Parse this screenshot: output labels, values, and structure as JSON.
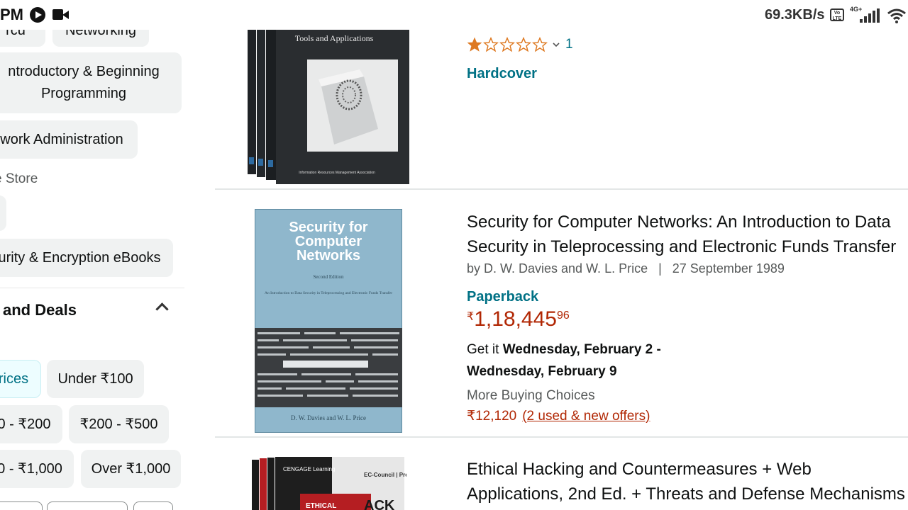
{
  "status_bar": {
    "time": "PM",
    "network_speed": "69.3KB/s",
    "volte": "Vo LTE",
    "network_type": "4G+"
  },
  "sidebar": {
    "partial_pills": [
      "rcu",
      "Networking"
    ],
    "intro_programming": "ntroductory & Beginning\nProgramming",
    "network_admin": "work Administration",
    "store_label": "e Store",
    "encryption_ebooks": "urity & Encryption eBooks",
    "deals_heading": "and Deals",
    "price_filters": {
      "all_prices": "rices",
      "under_100": "Under ₹100",
      "r100_200": "0 - ₹200",
      "r200_500": "₹200 - ₹500",
      "r500_1000": "0 - ₹1,000",
      "over_1000": "Over ₹1,000"
    }
  },
  "results": {
    "item1": {
      "cover_subtitle": "Tools and Applications",
      "cover_footer": "Information Resources Management Association",
      "rating_count": "1",
      "format": "Hardcover"
    },
    "item2": {
      "cover_title": "Security for Computer Networks",
      "cover_edition": "Second Edition",
      "cover_subtitle": "An Introduction to Data Security in Teleprocessing and Electronic Funds Transfer",
      "cover_authors": "D. W. Davies and W. L. Price",
      "title_line1": "Security for Computer Networks: An Introduction to Data",
      "title_line2": "Security in Teleprocessing and Electronic Funds Transfer",
      "byline": "by D. W. Davies and W. L. Price   |   27 September 1989",
      "format": "Paperback",
      "price_symbol": "₹",
      "price_whole": "1,18,445",
      "price_fraction": "96",
      "delivery_prefix": "Get it ",
      "delivery_dates": "Wednesday, February 2 - Wednesday, February 9",
      "more_buying": "More Buying Choices",
      "offer_price": "₹12,120",
      "offer_link": "(2 used & new offers)"
    },
    "item3": {
      "cover_brand": "CENGAGE Learning",
      "cover_publisher": "EC-Council | Press",
      "cover_word": "ETHICAL",
      "title_line1": "Ethical Hacking and Countermeasures + Web",
      "title_line2": "Applications, 2nd Ed. + Threats and Defense Mechanisms"
    }
  },
  "colors": {
    "link_teal": "#007185",
    "price_red": "#b12704",
    "star_orange": "#de7921",
    "pill_bg": "#f0f2f2"
  }
}
